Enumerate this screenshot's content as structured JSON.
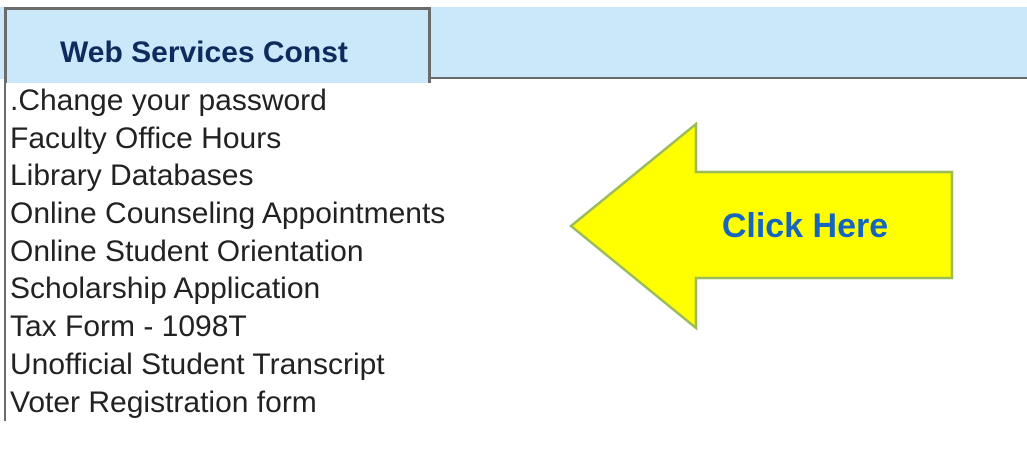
{
  "tab": {
    "label": "Web Services Const"
  },
  "links": [
    ".Change your password",
    "Faculty Office Hours",
    "Library Databases",
    "Online Counseling Appointments",
    "Online Student Orientation",
    "Scholarship Application",
    "Tax Form - 1098T",
    "Unofficial Student Transcript",
    "Voter Registration form"
  ],
  "callout": {
    "label": "Click Here",
    "fill_color": "#ffff00",
    "stroke_color": "#9bbb59",
    "text_color": "#1565c0"
  },
  "colors": {
    "tab_background": "#cbe7fa",
    "tab_text": "#0d2b5c",
    "link_text": "#222222"
  }
}
